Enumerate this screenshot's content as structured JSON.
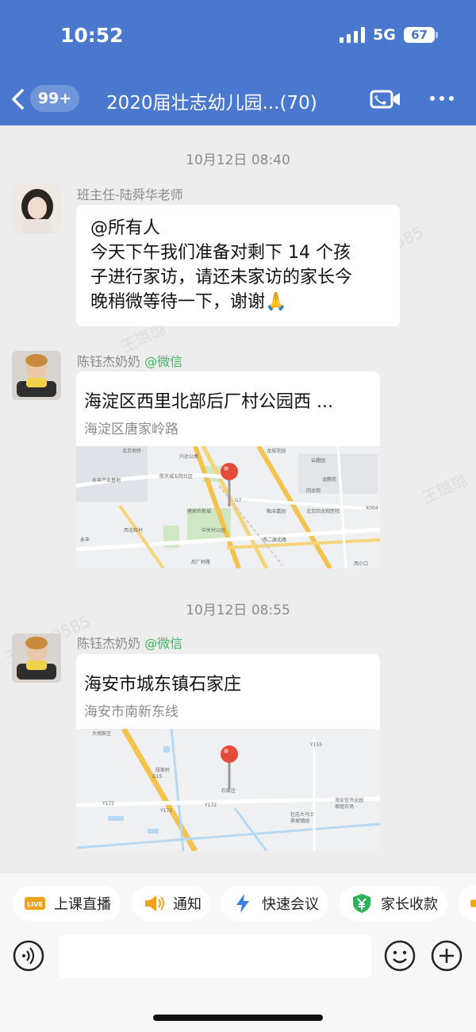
{
  "status_bar": {
    "time": "10:52",
    "network": "5G",
    "battery": "67"
  },
  "nav": {
    "unread_badge": "99+",
    "title": "2020届壮志幼儿园...(70)"
  },
  "messages": [
    {
      "timestamp": "10月12日 08:40",
      "sender": "班主任-陆舜华老师",
      "lines": [
        "@所有人",
        "今天下午我们准备对剩下 14 个孩",
        "子进行家访，请还未家访的家长今",
        "晚稍微等待一下，谢谢🙏"
      ]
    },
    {
      "sender_name": "陈钰杰奶奶",
      "sender_tag": "@微信",
      "location_title": "海淀区西里北部后厂村公园西 ...",
      "location_sub": "海淀区唐家岭路",
      "map_labels": [
        "北京地铁 ·",
        "兴达公寓",
        "龙城花园",
        "云趣园",
        "航天城五院社区",
        "G7",
        "回龙观",
        "永丰产业基地",
        "唐家岭新城",
        "龙腾苑",
        "中关村公园",
        "融泽嘉园",
        "北京回龙观医院",
        "X004",
        "西北旺村",
        "后厂村路",
        "西二旗北路",
        "西小口",
        "永丰"
      ]
    },
    {
      "timestamp": "10月12日 08:55",
      "sender_name": "陈钰杰奶奶",
      "sender_tag": "@微信",
      "location_title": "海安市城东镇石家庄",
      "location_sub": "海安市南新东线",
      "map_labels": [
        "大胡家庄",
        "Y155",
        "段家村",
        "G15",
        "石家庄",
        "Y172",
        "Y172",
        "Y172",
        "壮志大马士",
        "茶坡镇园",
        "海安信书全园",
        "家庭农场"
      ]
    }
  ],
  "toolbar": {
    "items": [
      {
        "label": "上课直播",
        "icon": "live-icon"
      },
      {
        "label": "通知",
        "icon": "speaker-icon"
      },
      {
        "label": "快速会议",
        "icon": "lightning-icon"
      },
      {
        "label": "家长收款",
        "icon": "yen-shield-icon"
      }
    ],
    "live_badge": "LIVE"
  },
  "watermarks": [
    "王璐璐 9585",
    "王璐璐",
    "王璐璐 9585",
    "王璐璐 9585",
    "王璐璐 9585",
    "王璐璐"
  ],
  "colors": {
    "header": "#4a78cf",
    "wechat_tag": "#3fb660",
    "map_road": "#f3c34d",
    "pin": "#e64a3b"
  }
}
